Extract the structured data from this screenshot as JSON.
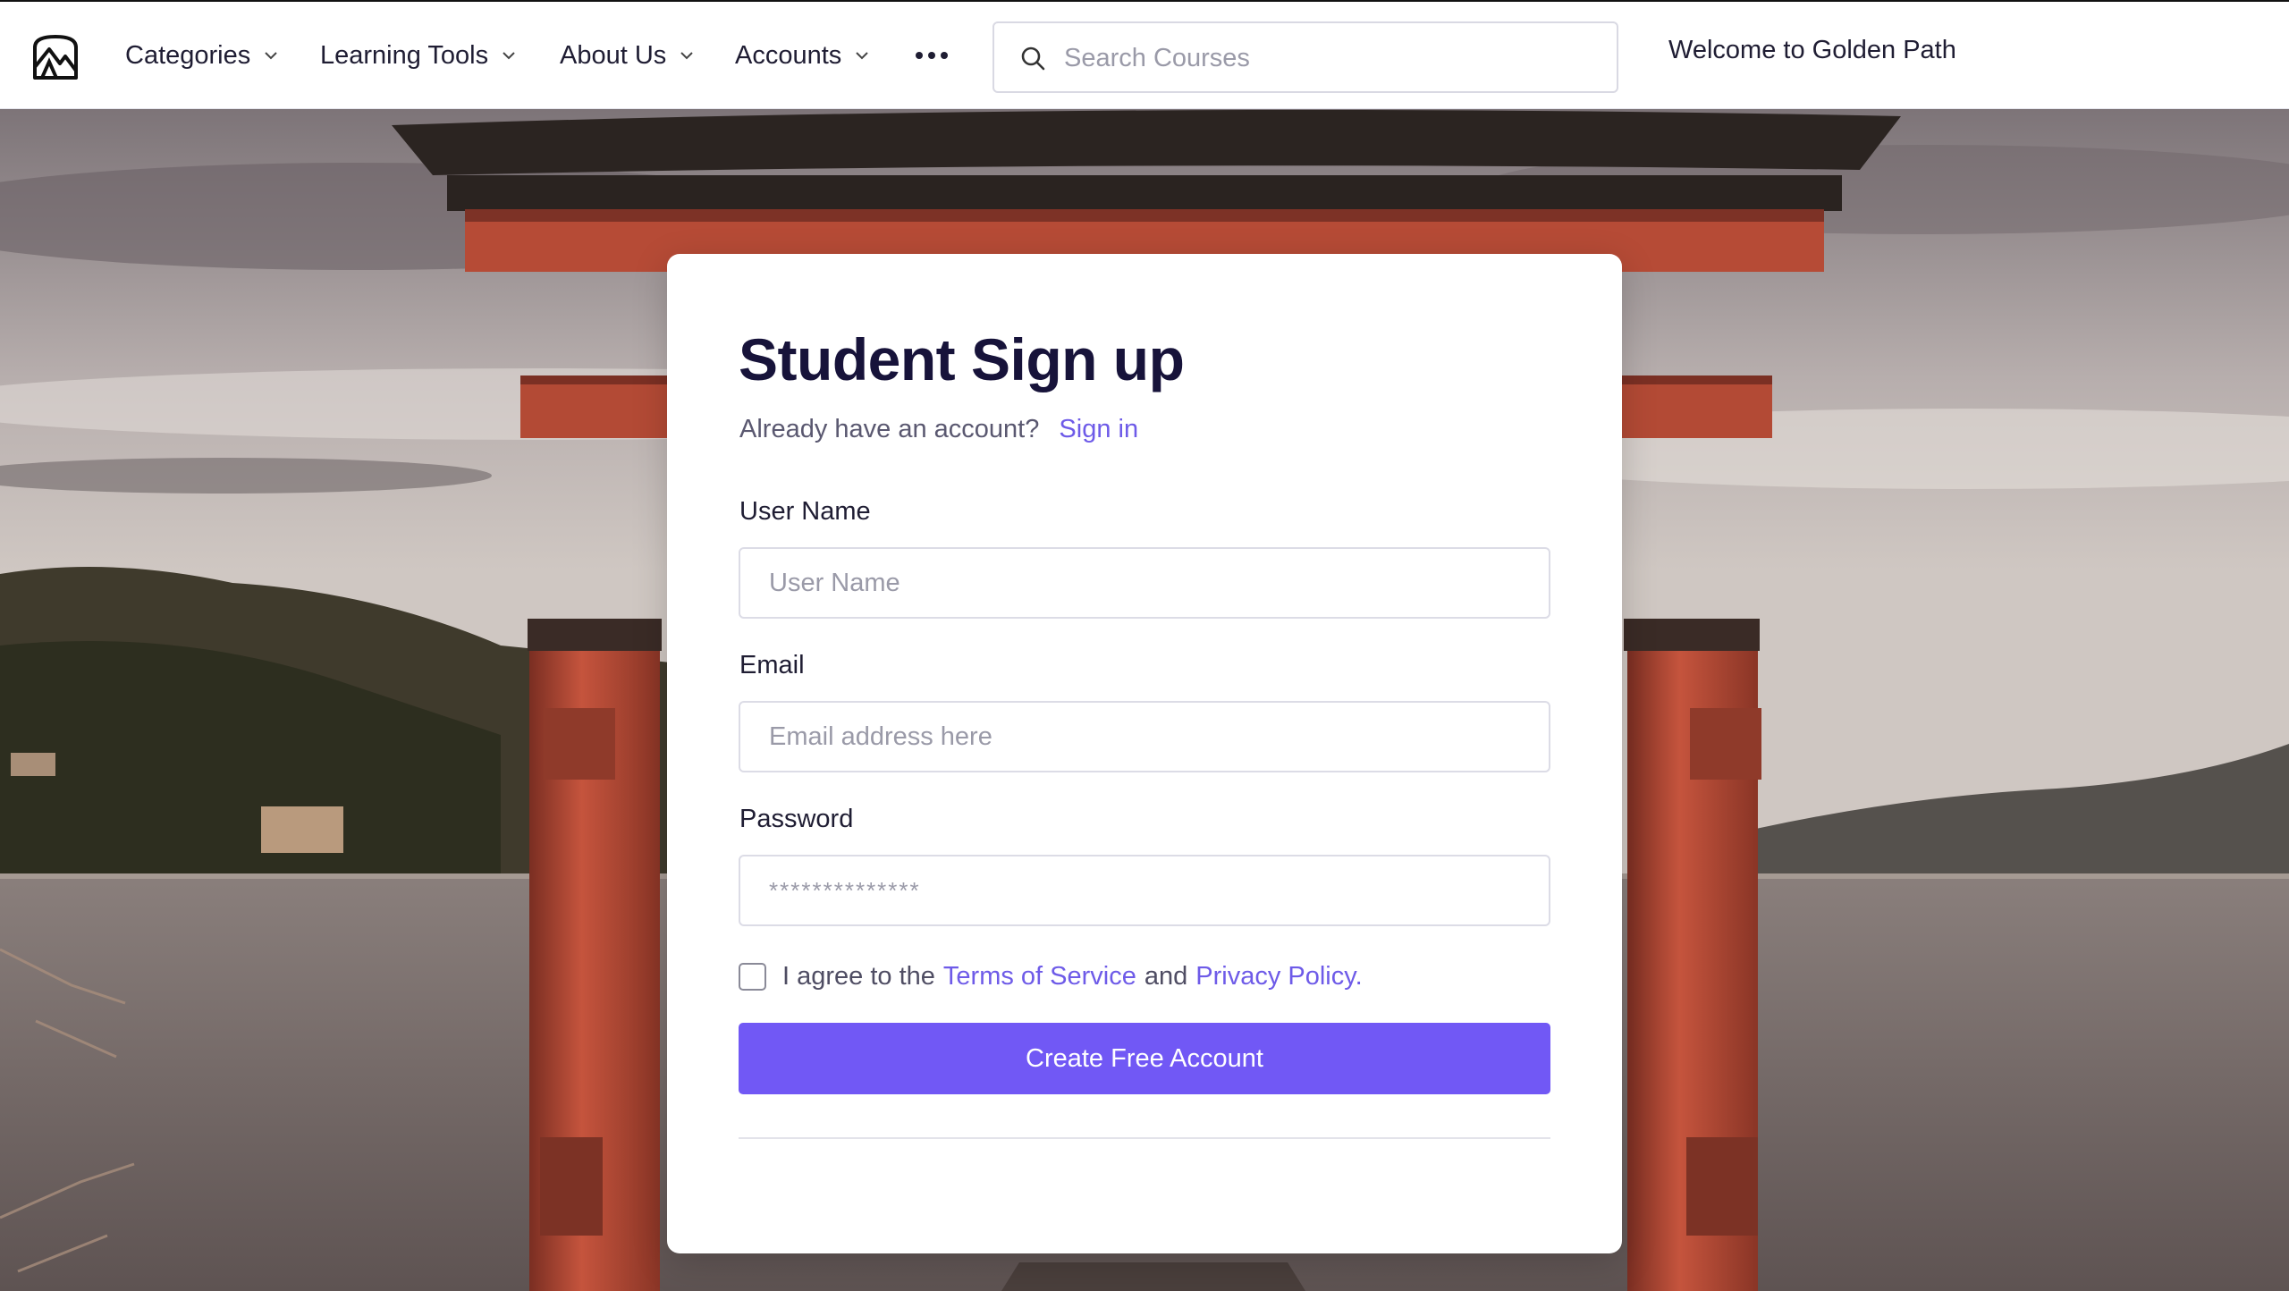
{
  "navbar": {
    "logo_icon": "mountain-logo-icon",
    "items": [
      {
        "label": "Categories",
        "icon": "chevron-down-icon"
      },
      {
        "label": "Learning Tools",
        "icon": "chevron-down-icon"
      },
      {
        "label": "About Us",
        "icon": "chevron-down-icon"
      },
      {
        "label": "Accounts",
        "icon": "chevron-down-icon"
      }
    ],
    "more_icon": "more-horizontal-icon",
    "search": {
      "placeholder": "Search Courses",
      "value": "",
      "icon": "search-icon"
    },
    "welcome_text": "Welcome to Golden Path"
  },
  "hero": {
    "image": "torii-gate-lake-photo"
  },
  "signup": {
    "title": "Student Sign up",
    "account_prompt": "Already have an account?",
    "sign_in_label": "Sign in",
    "fields": {
      "username": {
        "label": "User Name",
        "placeholder": "User Name",
        "value": ""
      },
      "email": {
        "label": "Email",
        "placeholder": "Email address here",
        "value": ""
      },
      "password": {
        "label": "Password",
        "placeholder": "**************",
        "value": ""
      }
    },
    "agree": {
      "checked": false,
      "prefix": "I agree to the",
      "terms_label": "Terms of Service",
      "and_text": "and",
      "privacy_label": "Privacy Policy."
    },
    "submit_label": "Create Free Account"
  },
  "colors": {
    "accent": "#7158f5",
    "link": "#6e5be8",
    "heading": "#17133a",
    "torii_red": "#c5543d"
  }
}
